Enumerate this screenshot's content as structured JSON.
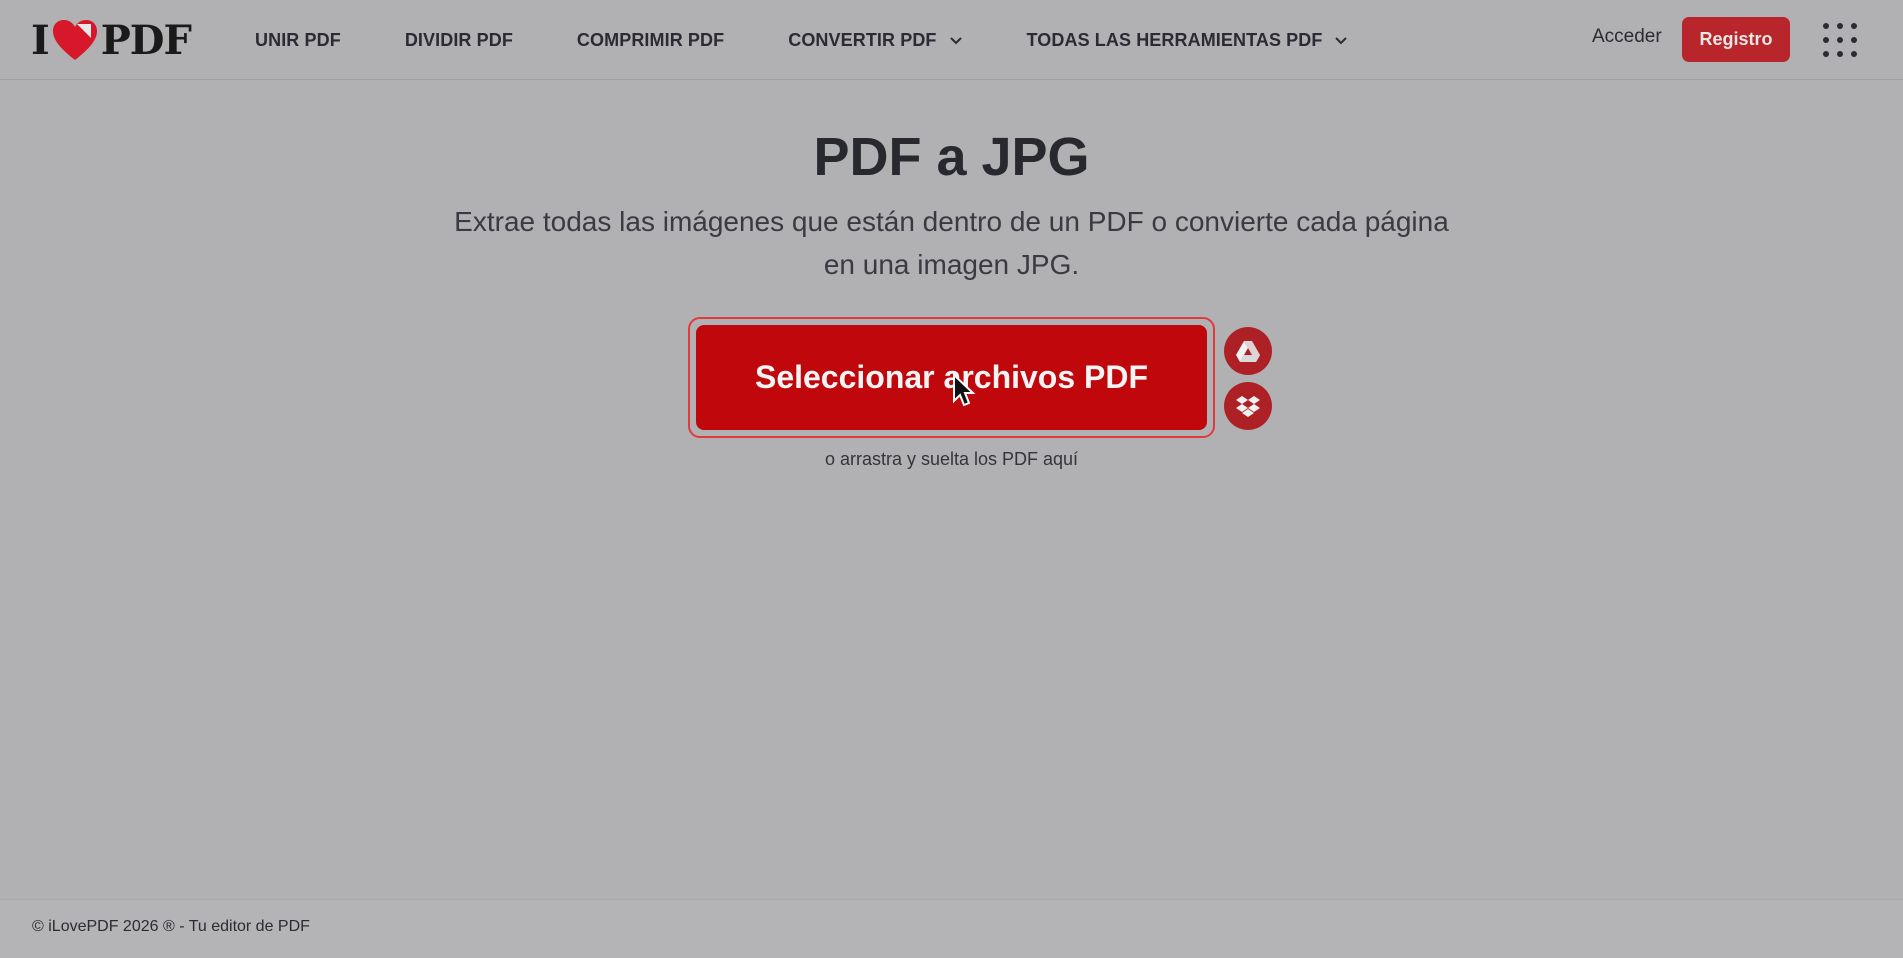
{
  "header": {
    "logo": {
      "left": "I",
      "right": "PDF"
    },
    "nav": [
      {
        "label": "UNIR PDF",
        "dropdown": false
      },
      {
        "label": "DIVIDIR PDF",
        "dropdown": false
      },
      {
        "label": "COMPRIMIR PDF",
        "dropdown": false
      },
      {
        "label": "CONVERTIR PDF",
        "dropdown": true
      },
      {
        "label": "TODAS LAS HERRAMIENTAS PDF",
        "dropdown": true
      }
    ],
    "login_label": "Acceder",
    "register_label": "Registro"
  },
  "main": {
    "title": "PDF a JPG",
    "subtitle": "Extrae todas las imágenes que están dentro de un PDF o convierte cada página en una imagen JPG.",
    "select_button_label": "Seleccionar archivos PDF",
    "drop_hint": "o arrastra y suelta los PDF aquí",
    "cloud_sources": [
      "google-drive-icon",
      "dropbox-icon"
    ]
  },
  "footer": {
    "text": "© iLovePDF 2026 ® - Tu editor de PDF"
  },
  "colors": {
    "accent": "#c0070c",
    "register_bg": "#b8252a",
    "overlay_bg": "#b1b1b3"
  }
}
